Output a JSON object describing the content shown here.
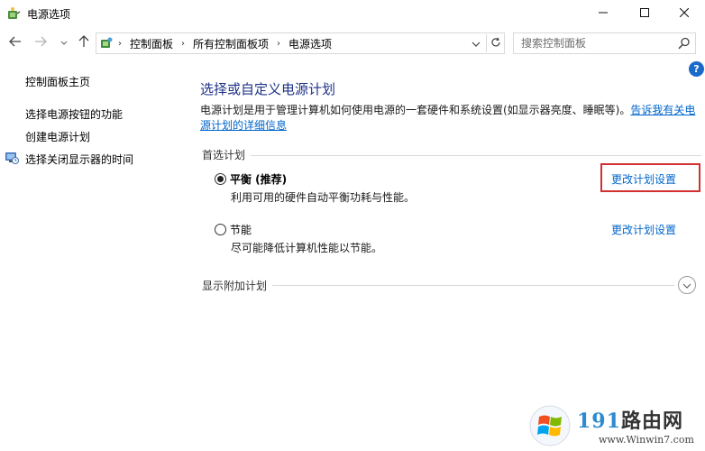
{
  "window": {
    "title": "电源选项",
    "minimize_icon": "minimize-icon",
    "maximize_icon": "maximize-icon",
    "close_icon": "close-icon"
  },
  "nav": {
    "breadcrumbs": [
      "控制面板",
      "所有控制面板项",
      "电源选项"
    ],
    "search_placeholder": "搜索控制面板"
  },
  "sidebar": {
    "home": "控制面板主页",
    "items": [
      {
        "label": "选择电源按钮的功能"
      },
      {
        "label": "创建电源计划"
      },
      {
        "label": "选择关闭显示器的时间"
      }
    ]
  },
  "main": {
    "title": "选择或自定义电源计划",
    "description": "电源计划是用于管理计算机如何使用电源的一套硬件和系统设置(如显示器亮度、睡眠等)。",
    "description_link": "告诉我有关电源计划的详细信息",
    "preferred_label": "首选计划",
    "plans": [
      {
        "name": "平衡 (推荐)",
        "description": "利用可用的硬件自动平衡功耗与性能。",
        "selected": true,
        "link": "更改计划设置"
      },
      {
        "name": "节能",
        "description": "尽可能降低计算机性能以节能。",
        "selected": false,
        "link": "更改计划设置"
      }
    ],
    "more_plans_label": "显示附加计划"
  },
  "watermark": {
    "brand_num": "191",
    "brand_text": "路由网",
    "url": "www.Winwin7.com"
  },
  "colors": {
    "accent_link": "#0066cc",
    "heading": "#1e3287",
    "highlight": "#d32f2f"
  }
}
